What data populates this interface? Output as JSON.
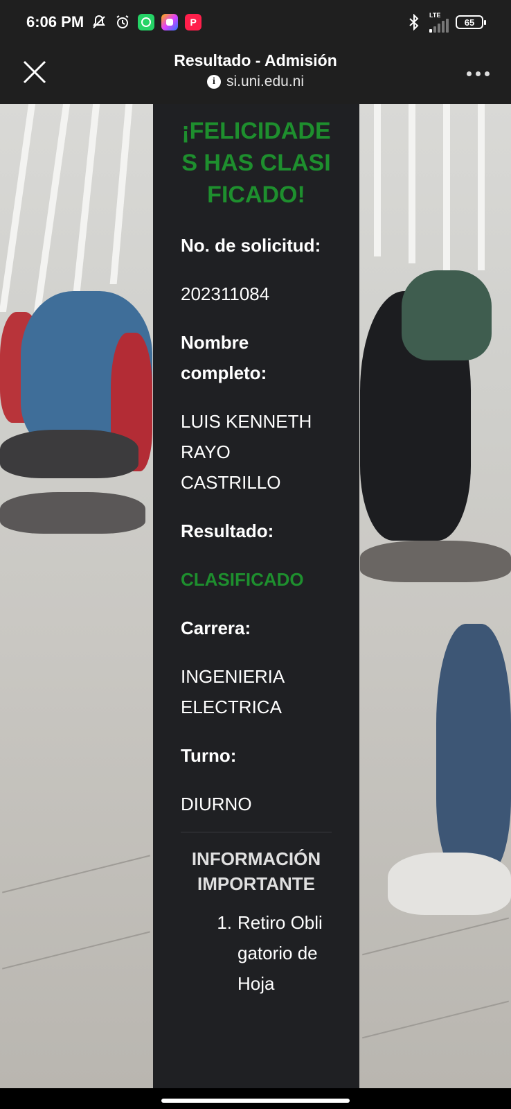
{
  "status_bar": {
    "time": "6:06 PM",
    "icons": [
      "mute-notifications-icon",
      "alarm-icon",
      "whatsapp-icon",
      "app-icon",
      "p-app-icon",
      "bluetooth-icon"
    ],
    "network": "LTE",
    "battery": "65"
  },
  "browser": {
    "title": "Resultado - Admisión",
    "url": "si.uni.edu.ni"
  },
  "result_card": {
    "headline": "¡FELICIDADES HAS CLASIFICADO!",
    "application_label": "No. de solicitud:",
    "application_value": "202311084",
    "name_label": "Nombre completo:",
    "name_value": "LUIS KENNETH RAYO CASTRILLO",
    "result_label": "Resultado:",
    "result_value": "CLASIFICADO",
    "career_label": "Carrera:",
    "career_value": "INGENIERIA ELECTRICA",
    "shift_label": "Turno:",
    "shift_value": "DIURNO",
    "info_title": "INFORMACIÓN IMPORTANTE",
    "info_items": [
      {
        "number": "1.",
        "text": "Retiro Obligatorio de Hoja"
      }
    ]
  },
  "colors": {
    "accent_green": "#1e8f2e",
    "card_bg": "#1f2023",
    "chrome_bg": "#1f1f1f"
  }
}
